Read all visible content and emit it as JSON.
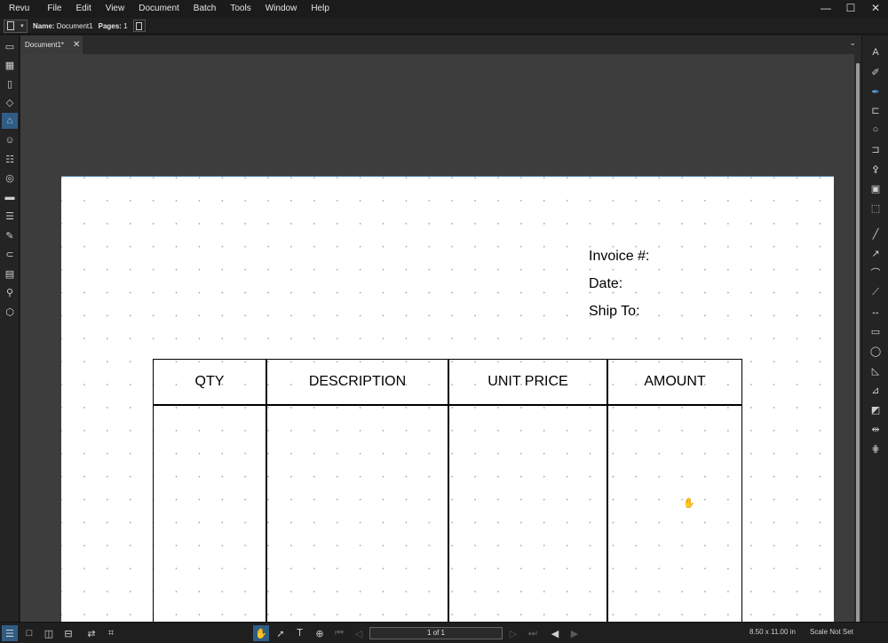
{
  "menu": [
    "Revu",
    "File",
    "Edit",
    "View",
    "Document",
    "Batch",
    "Tools",
    "Window",
    "Help"
  ],
  "window_controls": {
    "minimize": "—",
    "maximize": "☐",
    "close": "✕"
  },
  "properties": {
    "name_label": "Name:",
    "name_value": "Document1",
    "pages_label": "Pages:",
    "pages_value": "1"
  },
  "tabs": [
    {
      "label": "Document1*",
      "close": "✕"
    }
  ],
  "tabs_menu": "⌄",
  "document": {
    "fields": [
      "Invoice #:",
      "Date:",
      "Ship To:"
    ],
    "table_headers": [
      "QTY",
      "DESCRIPTION",
      "UNIT PRICE",
      "AMOUNT"
    ]
  },
  "status": {
    "page_indicator": "1 of 1",
    "page_size": "8.50 x 11.00 in",
    "scale": "Scale Not Set"
  },
  "left_panel_icons": [
    "thumbnails-icon",
    "bookmarks-icon",
    "file-access-icon",
    "layers-icon",
    "tool-chest-icon",
    "properties-icon",
    "markups-list-icon",
    "spaces-icon",
    "measurements-icon",
    "forms-icon",
    "signatures-icon",
    "links-icon",
    "studio-icon",
    "search-icon",
    "3d-icon"
  ],
  "right_panel_icons": [
    "text-box-icon",
    "highlight-icon",
    "pen-icon",
    "callout-icon",
    "cloud-icon",
    "cloud-callout-icon",
    "stamp-icon",
    "image-icon",
    "snapshot-icon",
    "line-icon",
    "arrow-icon",
    "arc-icon",
    "polyline-icon",
    "dimension-icon",
    "rectangle-icon",
    "ellipse-icon",
    "polygon-icon",
    "area-icon",
    "perimeter-icon",
    "length-icon",
    "count-icon"
  ],
  "accent_color": "#2f5d86"
}
